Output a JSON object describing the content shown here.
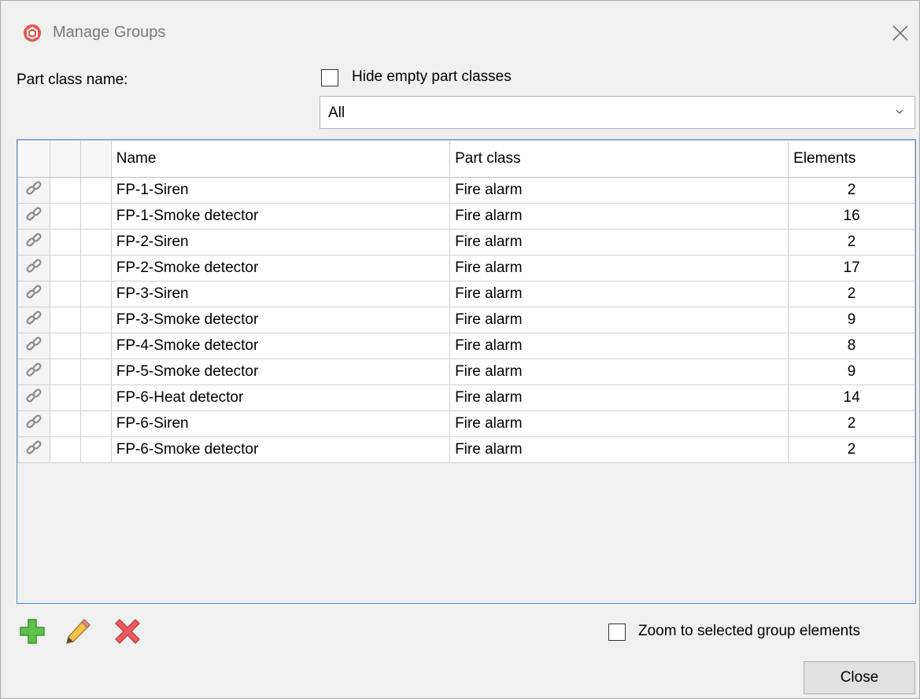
{
  "window": {
    "title": "Manage Groups"
  },
  "filter": {
    "part_class_label": "Part class name:",
    "hide_empty_label": "Hide empty part classes",
    "hide_empty_checked": false,
    "part_class_selected": "All"
  },
  "grid": {
    "headers": {
      "name": "Name",
      "part_class": "Part class",
      "elements": "Elements"
    },
    "rows": [
      {
        "name": "FP-1-Siren",
        "part_class": "Fire alarm",
        "elements": "2"
      },
      {
        "name": "FP-1-Smoke detector",
        "part_class": "Fire alarm",
        "elements": "16"
      },
      {
        "name": "FP-2-Siren",
        "part_class": "Fire alarm",
        "elements": "2"
      },
      {
        "name": "FP-2-Smoke detector",
        "part_class": "Fire alarm",
        "elements": "17"
      },
      {
        "name": "FP-3-Siren",
        "part_class": "Fire alarm",
        "elements": "2"
      },
      {
        "name": "FP-3-Smoke detector",
        "part_class": "Fire alarm",
        "elements": "9"
      },
      {
        "name": "FP-4-Smoke detector",
        "part_class": "Fire alarm",
        "elements": "8"
      },
      {
        "name": "FP-5-Smoke detector",
        "part_class": "Fire alarm",
        "elements": "9"
      },
      {
        "name": "FP-6-Heat detector",
        "part_class": "Fire alarm",
        "elements": "14"
      },
      {
        "name": "FP-6-Siren",
        "part_class": "Fire alarm",
        "elements": "2"
      },
      {
        "name": "FP-6-Smoke detector",
        "part_class": "Fire alarm",
        "elements": "2"
      }
    ]
  },
  "toolbar": {
    "icons": [
      "plus-icon",
      "pencil-icon",
      "delete-icon"
    ]
  },
  "zoom": {
    "label": "Zoom to selected group elements",
    "checked": false
  },
  "buttons": {
    "close": "Close"
  },
  "colors": {
    "accent_border": "#5a8ac0",
    "app_icon": "#e8534a",
    "add_green": "#4caf3c",
    "delete_red": "#e0474c"
  }
}
